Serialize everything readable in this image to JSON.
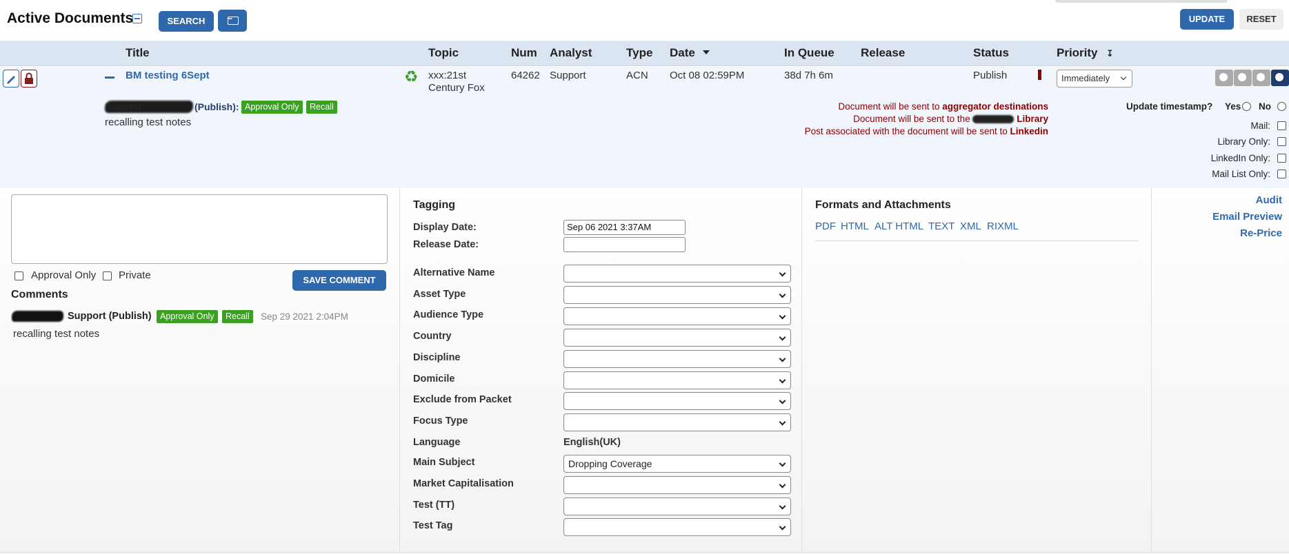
{
  "header": {
    "title": "Active Documents",
    "search_label": "SEARCH",
    "update_label": "UPDATE",
    "reset_label": "RESET"
  },
  "columns": [
    "Title",
    "Topic",
    "Num",
    "Analyst",
    "Type",
    "Date",
    "In Queue",
    "Release",
    "Status",
    "Priority"
  ],
  "document": {
    "title": "BM testing 6Sept",
    "topic_line1": "xxx:21st",
    "topic_line2": "Century Fox",
    "num": "64262",
    "analyst": "Support",
    "type": "ACN",
    "date": "Oct 08 02:59PM",
    "in_queue": "38d 7h 6m",
    "release": "",
    "status": "Publish",
    "priority": "Immediately",
    "comment_author": "(Publish):",
    "comment_author_partial": "Support",
    "badge_approval": "Approval Only",
    "badge_recall": "Recall",
    "comment_note": "recalling test notes",
    "notices": {
      "aggregator_prefix": "Document will be sent to ",
      "aggregator_bold": "aggregator destinations",
      "library_prefix": "Document will be sent to the ",
      "library_bold": "Library",
      "linkedin_prefix": "Post associated with the document will be sent to ",
      "linkedin_bold": "Linkedin"
    },
    "options": {
      "update_timestamp": "Update timestamp?",
      "yes": "Yes",
      "no": "No",
      "mail": "Mail:",
      "library_only": "Library Only:",
      "linkedin_only": "LinkedIn Only:",
      "mail_list_only": "Mail List Only:"
    }
  },
  "comments_panel": {
    "approval_only": "Approval Only",
    "private": "Private",
    "save_comment": "SAVE COMMENT",
    "heading": "Comments",
    "entry": {
      "author": "Support (Publish)",
      "badge_approval": "Approval Only",
      "badge_recall": "Recall",
      "timestamp": "Sep 29 2021 2:04PM",
      "text": "recalling test notes"
    }
  },
  "tagging": {
    "heading": "Tagging",
    "display_date_label": "Display Date:",
    "display_date_value": "Sep 06 2021 3:37AM",
    "release_date_label": "Release Date:",
    "release_date_value": "",
    "fields": [
      {
        "label": "Alternative Name",
        "value": ""
      },
      {
        "label": "Asset Type",
        "value": ""
      },
      {
        "label": "Audience Type",
        "value": ""
      },
      {
        "label": "Country",
        "value": ""
      },
      {
        "label": "Discipline",
        "value": ""
      },
      {
        "label": "Domicile",
        "value": ""
      },
      {
        "label": "Exclude from Packet",
        "value": ""
      },
      {
        "label": "Focus Type",
        "value": ""
      },
      {
        "label": "Language",
        "value": "English(UK)"
      },
      {
        "label": "Main Subject",
        "value": "Dropping Coverage"
      },
      {
        "label": "Market Capitalisation",
        "value": ""
      },
      {
        "label": "Test (TT)",
        "value": ""
      },
      {
        "label": "Test Tag",
        "value": ""
      }
    ]
  },
  "formats": {
    "heading": "Formats and Attachments",
    "links": [
      "PDF",
      "HTML",
      "ALT HTML",
      "TEXT",
      "XML",
      "RIXML"
    ]
  },
  "side_links": [
    "Audit",
    "Email Preview",
    "Re-Price"
  ],
  "colors": {
    "accent": "#2f68ad",
    "header_bg": "#dbe5f1",
    "row_bg": "#f1f6fc",
    "badge_green": "#3aa020",
    "notice_red": "#8b0000"
  }
}
